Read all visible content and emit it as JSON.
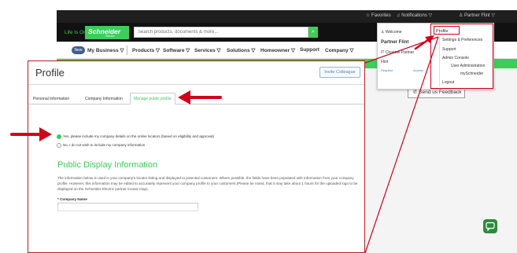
{
  "topbar": {
    "favorites": "☆ Favorites",
    "notifications": "♫ Notifications ▽",
    "partner": "♙ Partner Flint ▽"
  },
  "header": {
    "tagline": "Life Is On",
    "logo_name": "Schneider",
    "logo_sub": "Electric",
    "search_placeholder": "Search products, documents & more..."
  },
  "nav": {
    "new_badge": "New",
    "items": [
      "My Business ▽",
      "Products ▽",
      "Software ▽",
      "Services ▽",
      "Solutions ▽",
      "Homeowner ▽",
      "Support",
      "Company ▽"
    ]
  },
  "feedback_button": "✆ Send us Feedback",
  "dropdown": {
    "welcome": "♙ Welcome",
    "name": "Partner Flint",
    "company": "IT Channel Partner",
    "short_name": "Flint",
    "link_left": "Request",
    "link_mid": "Access",
    "menu": [
      "Profile",
      "Settings & Preferences",
      "Support",
      "Admin Console",
      "User Administration",
      "mySchneider",
      "Logout"
    ]
  },
  "panel": {
    "title": "Profile",
    "invite_button": "Invite Colleague",
    "tabs": [
      "Personal Information",
      "Company Information",
      "Manage public profile"
    ],
    "radio_yes": "Yes, please include my company details on the online locators (based on eligibility and approval)",
    "radio_no": "No, I do not wish to include my company information",
    "heading": "Public Display Information",
    "description": "The information below is used in your company's locator listing and displayed to potential customers. Where possible, the fields have been populated with information from your company profile. However, this information may be edited to accurately represent your company profile to your customers.(Please be noted, that it may take about 1 hours for the uploaded logo to be displayed on the Schneider-Electric partner locator map).",
    "company_label": "* Company Name"
  },
  "colors": {
    "brand_green": "#3dcd58",
    "annotation_red": "#d0021b",
    "dark_bar": "#1f1f1f"
  }
}
